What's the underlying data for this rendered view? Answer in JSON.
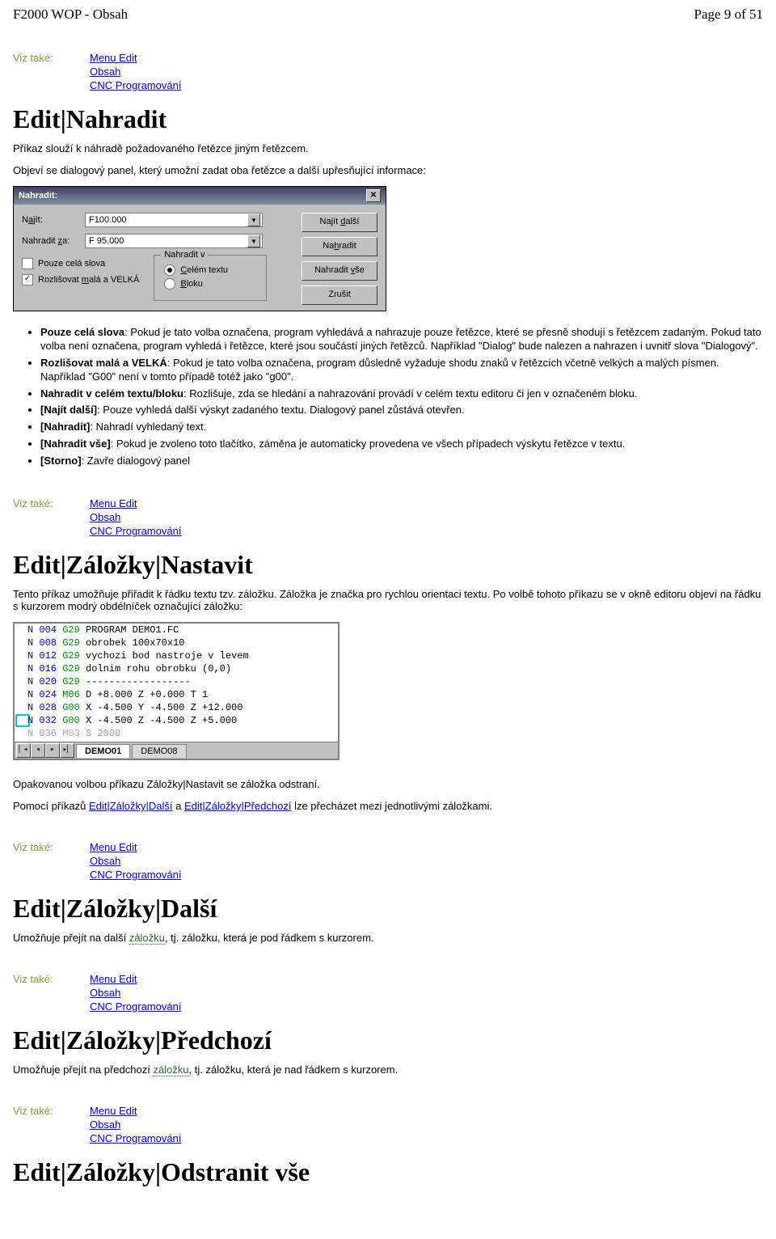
{
  "header": {
    "left": "F2000 WOP - Obsah",
    "right": "Page 9 of 51"
  },
  "seeAlso": {
    "label": "Viz také:",
    "links": [
      "Menu Edit",
      "Obsah",
      "CNC Programování"
    ]
  },
  "sec1": {
    "title": "Edit|Nahradit",
    "intro": "Příkaz slouží k náhradě požadovaného řetězce jiným řetězcem.",
    "afterDialog": "Objeví se dialogový panel, který umožní zadat oba řetězce a další upřesňující informace:"
  },
  "dialog": {
    "title": "Nahradit:",
    "findLabelPre": "N",
    "findLabelUL": "a",
    "findLabelPost": "jít:",
    "findValue": "F100.000",
    "replaceLabelPre": "Nahradit ",
    "replaceLabelUL": "z",
    "replaceLabelPost": "a:",
    "replaceValue": "F 95.000",
    "chkWholeWords": "Pouze celá slova",
    "chkMatchCasePre": "Rozlišovat ",
    "chkMatchCaseUL": "m",
    "chkMatchCasePost": "alá a VELKÁ",
    "groupTitle": "Nahradit v",
    "radioWholePre": "",
    "radioWholeUL": "C",
    "radioWholePost": "elém textu",
    "radioBlockPre": "",
    "radioBlockUL": "B",
    "radioBlockPost": "loku",
    "btnFindNextPre": "Najít ",
    "btnFindNextUL": "d",
    "btnFindNextPost": "alší",
    "btnReplacePre": "Na",
    "btnReplaceUL": "h",
    "btnReplacePost": "radit",
    "btnReplaceAllPre": "Nahradit ",
    "btnReplaceAllUL": "v",
    "btnReplaceAllPost": "še",
    "btnCancel": "Zrušit"
  },
  "sec1bullets": {
    "b1a": "Pouze celá slova",
    "b1b": ": Pokud je tato volba označena, program vyhledává a nahrazuje pouze řetězce, které se přesně shodují s řetězcem zadaným. Pokud tato volba není označena, program vyhledá i řetězce, které jsou součástí jiných řetězců. Například \"Dialog\" bude nalezen a nahrazen i uvnitř slova \"Dialogový\".",
    "b2a": "Rozlišovat malá a VELKÁ",
    "b2b": ": Pokud je tato volba označena, program důsledně vyžaduje shodu znaků v řetězcích včetně velkých a malých písmen. Například \"G00\" není v tomto případě totéž jako \"g00\".",
    "b3a": "Nahradit v celém textu/bloku",
    "b3b": ": Rozlišuje, zda se hledání a nahrazování provádí v celém textu editoru či jen v označeném bloku.",
    "b4a": "[Najít další]",
    "b4b": ": Pouze vyhledá další výskyt zadaného textu. Dialogový panel zůstává otevřen.",
    "b5a": "[Nahradit]",
    "b5b": ": Nahradí vyhledaný text.",
    "b6a": "[Nahradit vše]",
    "b6b": ": Pokud je zvoleno toto tlačítko, záměna je automaticky provedena ve všech případech výskytu řetězce v textu.",
    "b7a": "[Storno]",
    "b7b": ": Zavře dialogový panel"
  },
  "sec2": {
    "title": "Edit|Záložky|Nastavit",
    "intro": "Tento příkaz umožňuje přiřadit k řádku textu tzv. záložku. Záložka je značka pro rychlou orientaci textu. Po volbě tohoto příkazu se v okně editoru objeví na řádku s kurzorem modrý obdélníček označující záložku:",
    "after": "Opakovanou volbou příkazu Záložky|Nastavit se záložka odstraní.",
    "nav1": "Pomocí příkazů ",
    "navLink1": "Edit|Záložky|Další",
    "nav2": " a ",
    "navLink2": "Edit|Záložky|Předchozí",
    "nav3": " lze přecházet mezi jednotlivými záložkami."
  },
  "editor": {
    "lines": [
      {
        "num": "N 004",
        "kw": "G29",
        "rest": " PROGRAM DEMO1.FC"
      },
      {
        "num": "N 008",
        "kw": "G29",
        "rest": " obrobek 100x70x10"
      },
      {
        "num": "N 012",
        "kw": "G29",
        "rest": " vychozi bod nastroje v levem"
      },
      {
        "num": "N 016",
        "kw": "G29",
        "rest": " dolnim rohu obrobku (0,0)"
      },
      {
        "num": "N 020",
        "kw": "G29",
        "rest": " ------------------"
      },
      {
        "num": "N 024",
        "kw": "M06",
        "rest": " D +8.000 Z +0.000 T 1"
      },
      {
        "num": "N 028",
        "kw": "G00",
        "rest": " X -4.500 Y -4.500 Z +12.000"
      },
      {
        "num": "N 032",
        "kw": "G00",
        "rest": " X -4.500 Z -4.500 Z +5.000",
        "bookmark": true
      },
      {
        "num": "N 036",
        "kw": "M03",
        "rest": " S 2000",
        "red": true,
        "faded": true
      }
    ],
    "tabs": {
      "active": "DEMO01",
      "other": "DEMO08"
    }
  },
  "sec3": {
    "title": "Edit|Záložky|Další",
    "text1": "Umožňuje přejít na další ",
    "link": "záložku",
    "text2": ", tj. záložku, která je pod řádkem s kurzorem."
  },
  "sec4": {
    "title": "Edit|Záložky|Předchozí",
    "text1": "Umožňuje přejít na předchozí ",
    "link": "záložku",
    "text2": ", tj. záložku, která je nad řádkem s kurzorem."
  },
  "sec5": {
    "title": "Edit|Záložky|Odstranit vše"
  }
}
